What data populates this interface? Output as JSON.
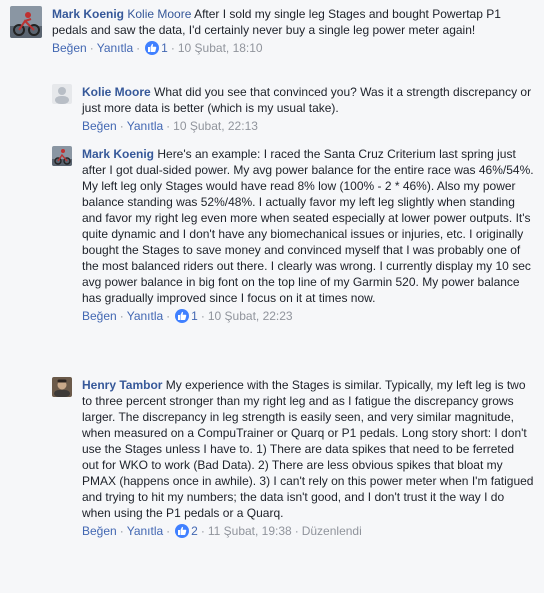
{
  "comments": [
    {
      "author": "Mark Koenig",
      "mention": "Kolie Moore",
      "text": " After I sold my single leg Stages and bought Powertap P1 pedals and saw the data, I'd certainly never buy a single leg power meter again!",
      "like_label": "Beğen",
      "reply_label": "Yanıtla",
      "reactions": "1",
      "timestamp": "10 Şubat, 18:10",
      "edited": ""
    },
    {
      "author": "Kolie Moore",
      "mention": "",
      "text": " What did you see that convinced you? Was it a strength discrepancy or just more data is better (which is my usual take).",
      "like_label": "Beğen",
      "reply_label": "Yanıtla",
      "reactions": "",
      "timestamp": "10 Şubat, 22:13",
      "edited": ""
    },
    {
      "author": "Mark Koenig",
      "mention": "",
      "text": " Here's an example: I raced the Santa Cruz Criterium last spring just after I got dual-sided power. My avg power balance for the entire race was 46%/54%. My left leg only Stages would have read 8% low (100% - 2 * 46%). Also my power balance standing was 52%/48%. I actually favor my left leg slightly when standing and favor my right leg even more when seated especially at lower power outputs. It's quite dynamic and I don't have any biomechanical issues or injuries, etc. I originally bought the Stages to save money and convinced myself that I was probably one of the most balanced riders out there. I clearly was wrong. I currently display my 10 sec avg power balance in big font on the top line of my Garmin 520. My power balance has gradually improved since I focus on it at times now.",
      "like_label": "Beğen",
      "reply_label": "Yanıtla",
      "reactions": "1",
      "timestamp": "10 Şubat, 22:23",
      "edited": ""
    },
    {
      "author": "Henry Tambor",
      "mention": "",
      "text": " My experience with the Stages is similar. Typically, my left leg is two to three percent stronger than my right leg and as I fatigue the discrepancy grows larger. The discrepancy in leg strength is easily seen, and very similar magnitude, when measured on a CompuTrainer or Quarq or P1 pedals. Long story short: I don't use the Stages unless I have to. 1) There are data spikes that need to be ferreted out for WKO to work (Bad Data). 2) There are less obvious spikes that bloat my PMAX (happens once in awhile). 3) I can't rely on this power meter when I'm fatigued and trying to hit my numbers; the data isn't good, and I don't trust it the way I do when using the P1 pedals or a Quarq.",
      "like_label": "Beğen",
      "reply_label": "Yanıtla",
      "reactions": "2",
      "timestamp": "11 Şubat, 19:38",
      "edited": "Düzenlendi"
    }
  ],
  "colors": {
    "author": "#365899",
    "link": "#4267b2",
    "meta": "#90949c",
    "like_badge": "#4080ff",
    "background": "#f6f7f9"
  }
}
